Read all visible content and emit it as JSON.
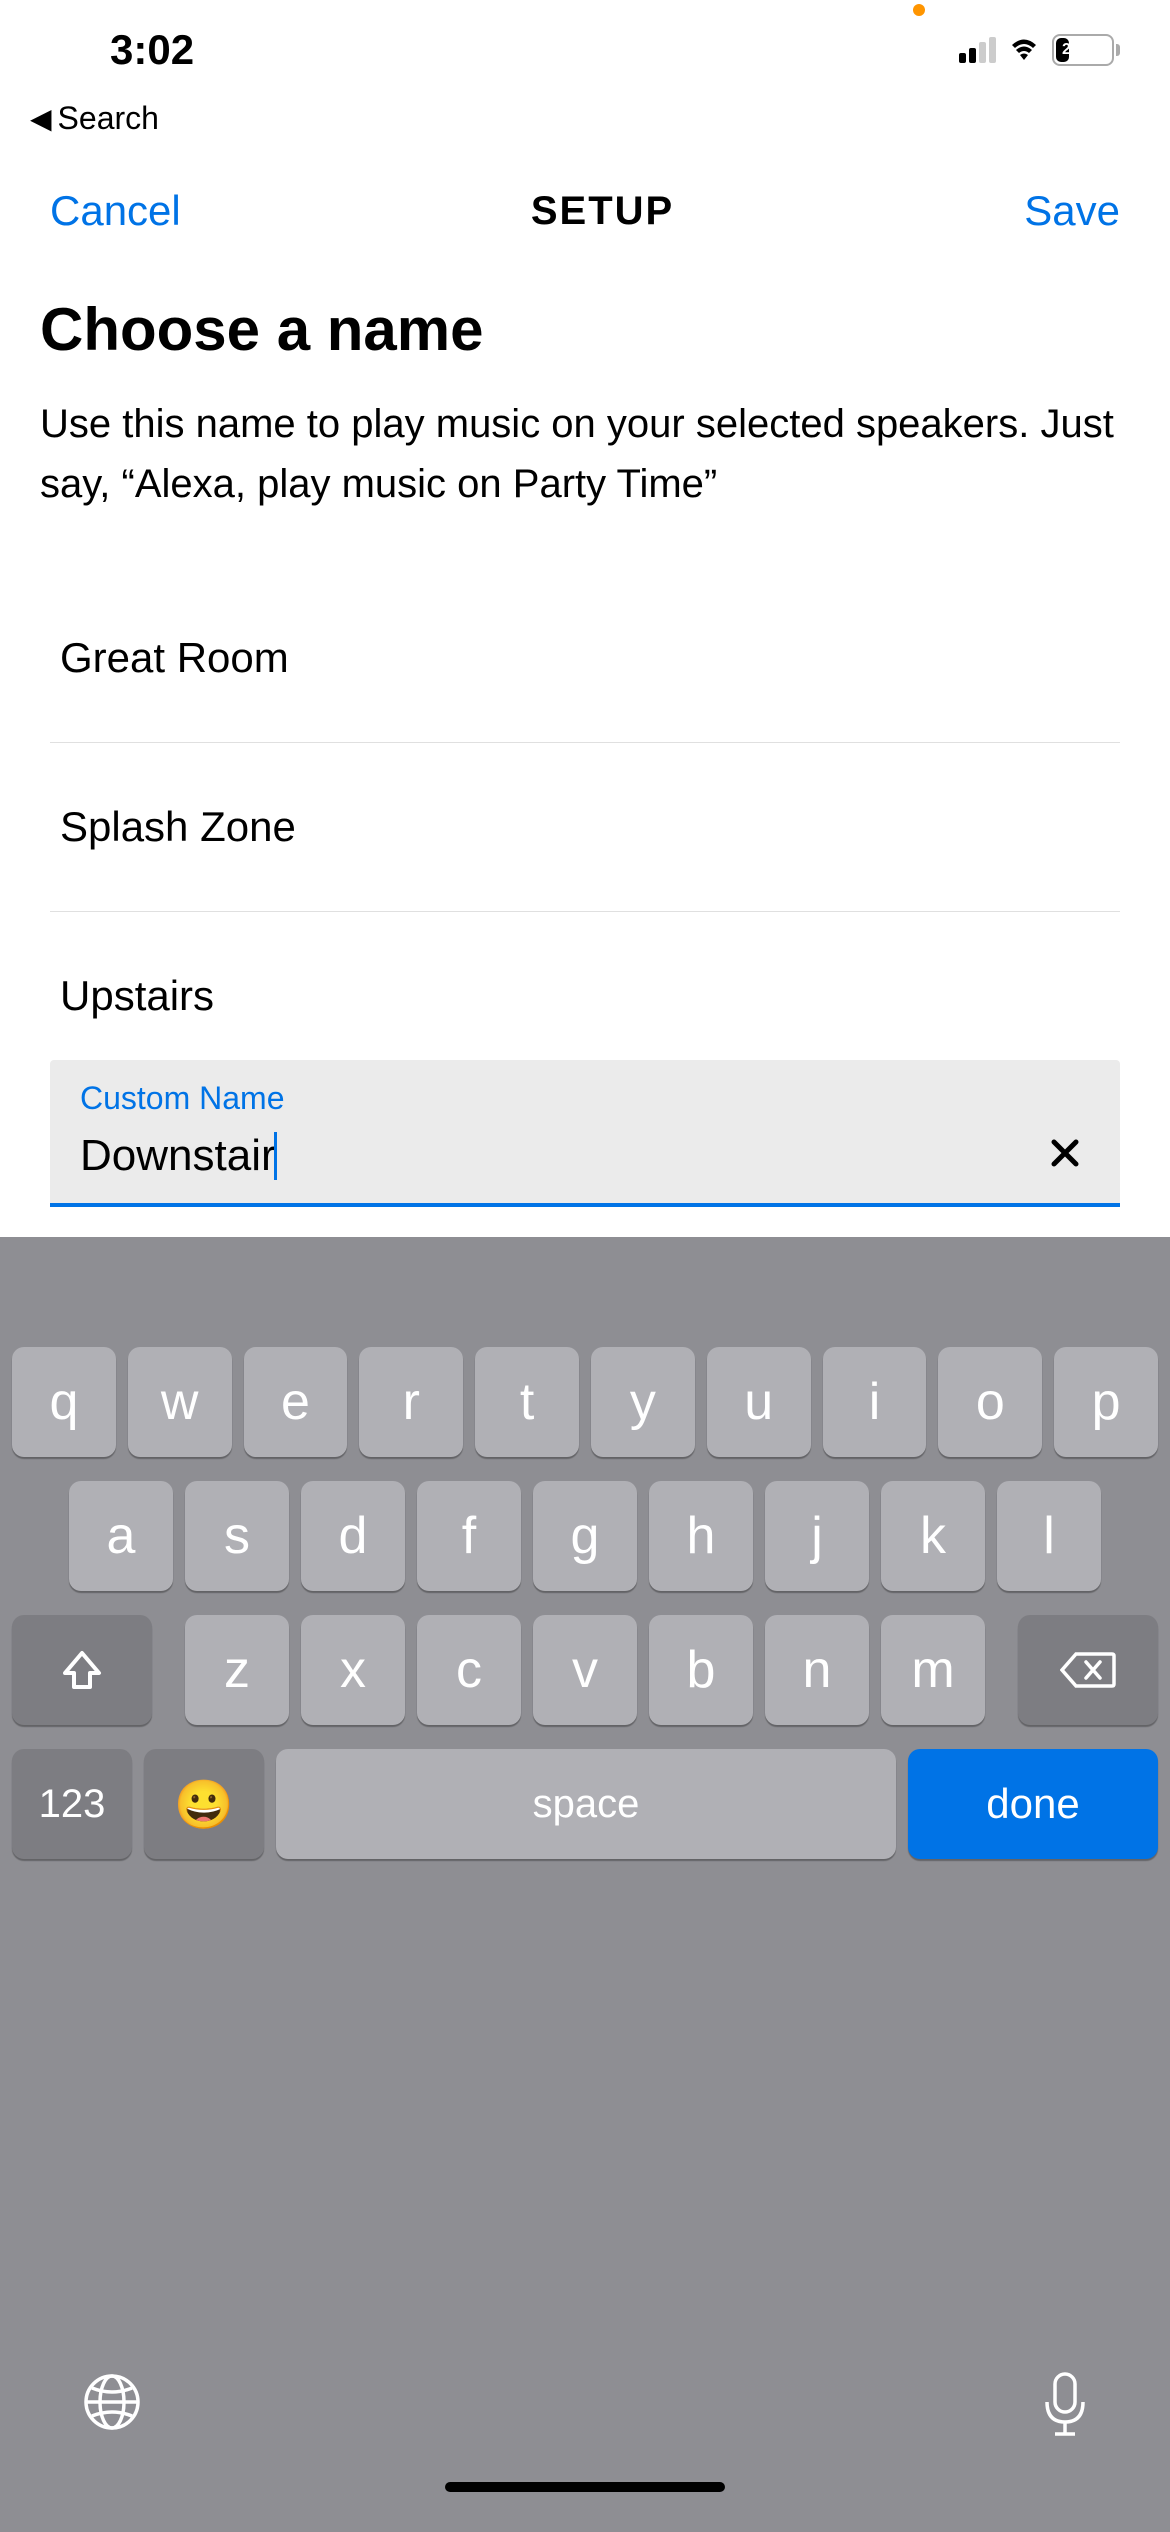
{
  "status": {
    "time": "3:02",
    "battery_percent": "23",
    "back_label": "Search"
  },
  "nav": {
    "cancel": "Cancel",
    "title": "SETUP",
    "save": "Save"
  },
  "page": {
    "title": "Choose a name",
    "description": "Use this name to play music on your selected speakers. Just say, “Alexa, play music on Party Time”"
  },
  "suggestions": [
    "Great Room",
    "Splash Zone",
    "Upstairs"
  ],
  "input": {
    "label": "Custom Name",
    "value": "Downstair"
  },
  "keyboard": {
    "row1": [
      "q",
      "w",
      "e",
      "r",
      "t",
      "y",
      "u",
      "i",
      "o",
      "p"
    ],
    "row2": [
      "a",
      "s",
      "d",
      "f",
      "g",
      "h",
      "j",
      "k",
      "l"
    ],
    "row3": [
      "z",
      "x",
      "c",
      "v",
      "b",
      "n",
      "m"
    ],
    "numbers": "123",
    "space": "space",
    "done": "done"
  }
}
